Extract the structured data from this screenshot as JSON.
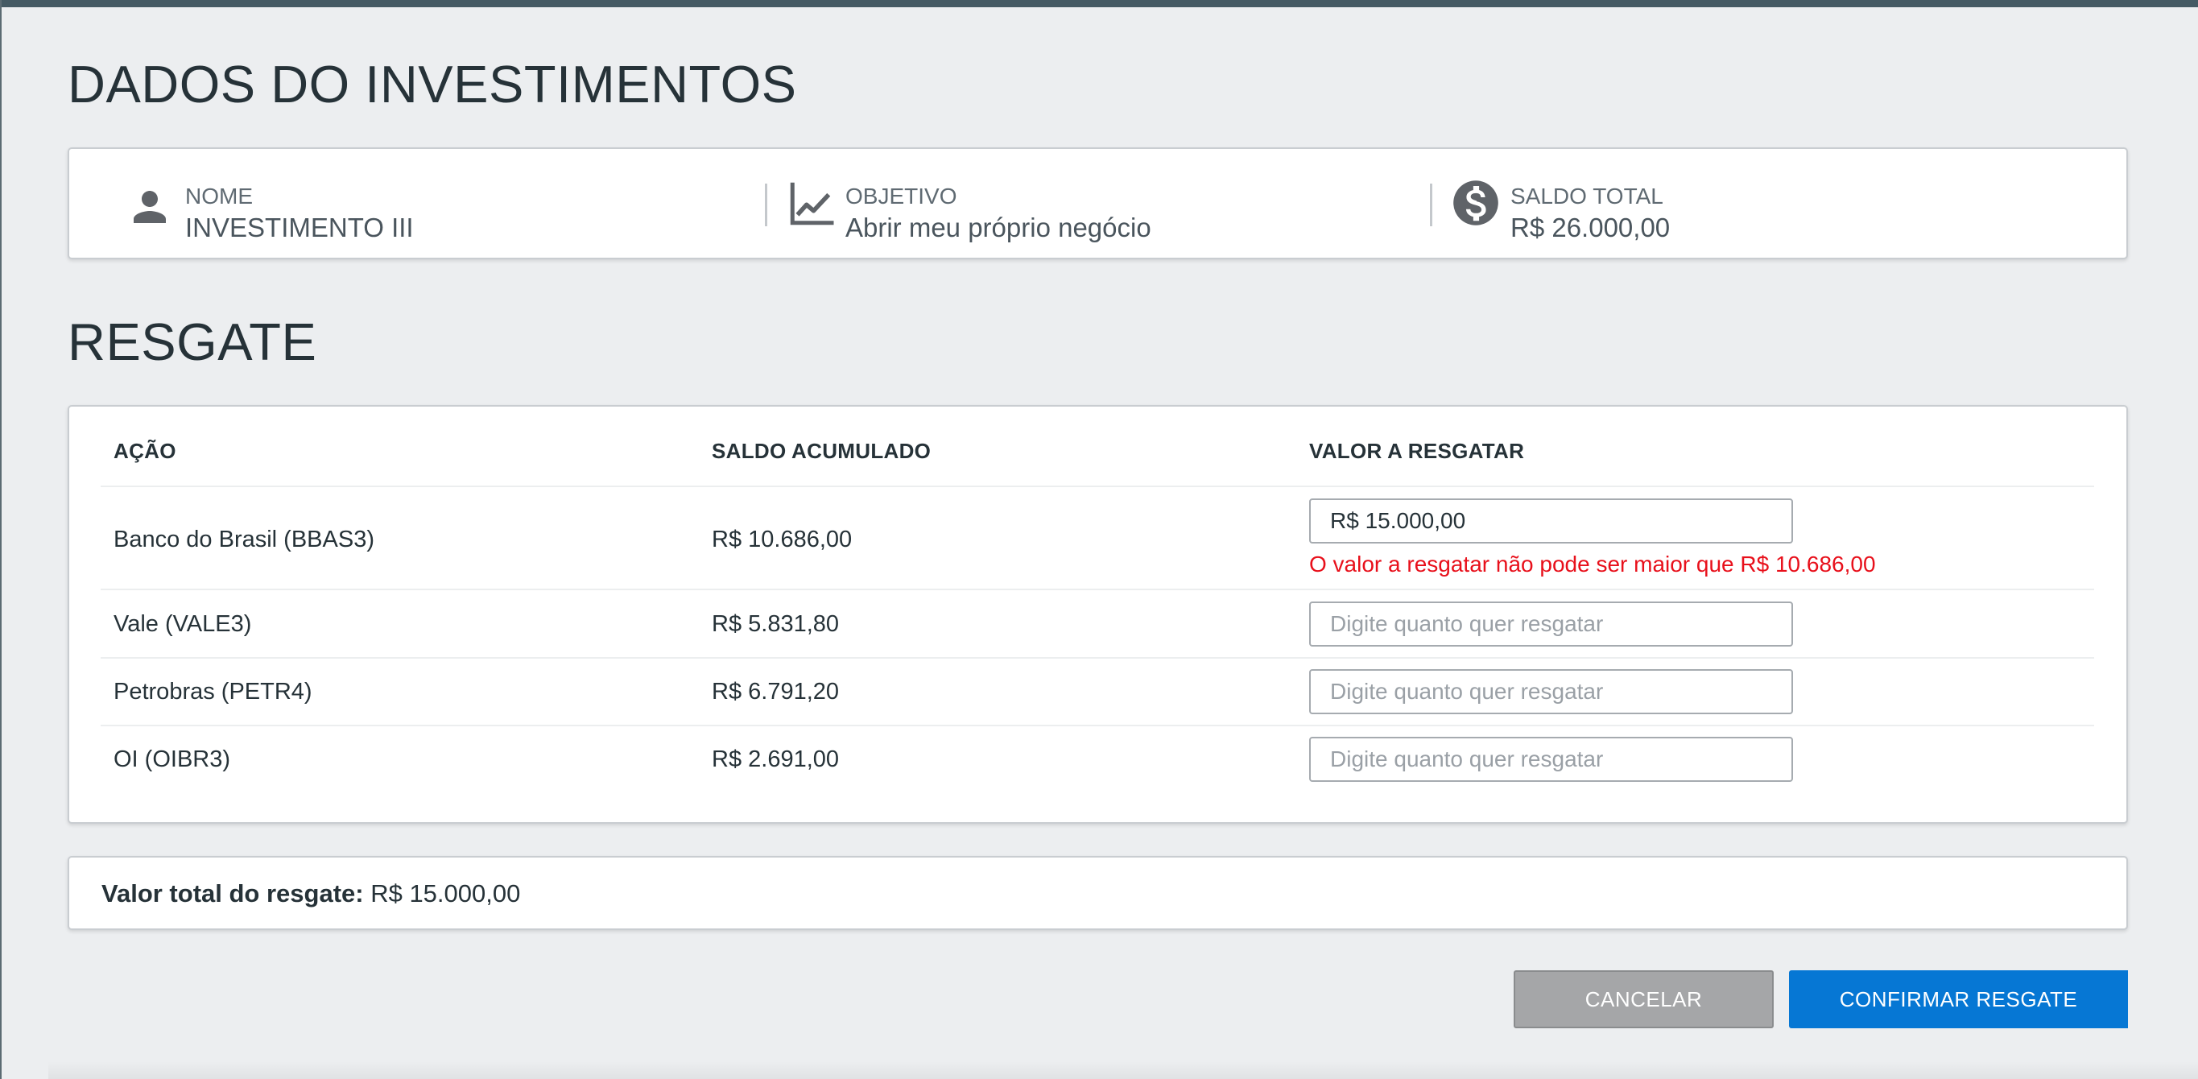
{
  "colors": {
    "accent": "#0677d4",
    "error": "#e8101b",
    "cancel_button": "#a5a6a8",
    "background": "#eceef0",
    "top_bar": "#455a64"
  },
  "investment": {
    "title": "DADOS DO INVESTIMENTOS",
    "name": {
      "icon": "person-icon",
      "label": "NOME",
      "value": "INVESTIMENTO III"
    },
    "goal": {
      "icon": "line-chart-icon",
      "label": "OBJETIVO",
      "value": "Abrir meu próprio negócio"
    },
    "balance": {
      "icon": "dollar-circle-icon",
      "label": "SALDO TOTAL",
      "value": "R$ 26.000,00"
    }
  },
  "redemption": {
    "title": "RESGATE",
    "columns": [
      "AÇÃO",
      "SALDO ACUMULADO",
      "VALOR A RESGATAR"
    ],
    "placeholder": "Digite quanto quer resgatar",
    "rows": [
      {
        "stock": "Banco do Brasil (BBAS3)",
        "balance": "R$ 10.686,00",
        "amount": "R$ 15.000,00",
        "error": "O valor a resgatar não pode ser maior que R$ 10.686,00"
      },
      {
        "stock": "Vale (VALE3)",
        "balance": "R$ 5.831,80",
        "amount": ""
      },
      {
        "stock": "Petrobras (PETR4)",
        "balance": "R$ 6.791,20",
        "amount": ""
      },
      {
        "stock": "OI (OIBR3)",
        "balance": "R$ 2.691,00",
        "amount": ""
      }
    ]
  },
  "total": {
    "label": "Valor total do resgate:",
    "value": "R$ 15.000,00"
  },
  "actions": {
    "cancel": "CANCELAR",
    "confirm": "CONFIRMAR RESGATE"
  }
}
